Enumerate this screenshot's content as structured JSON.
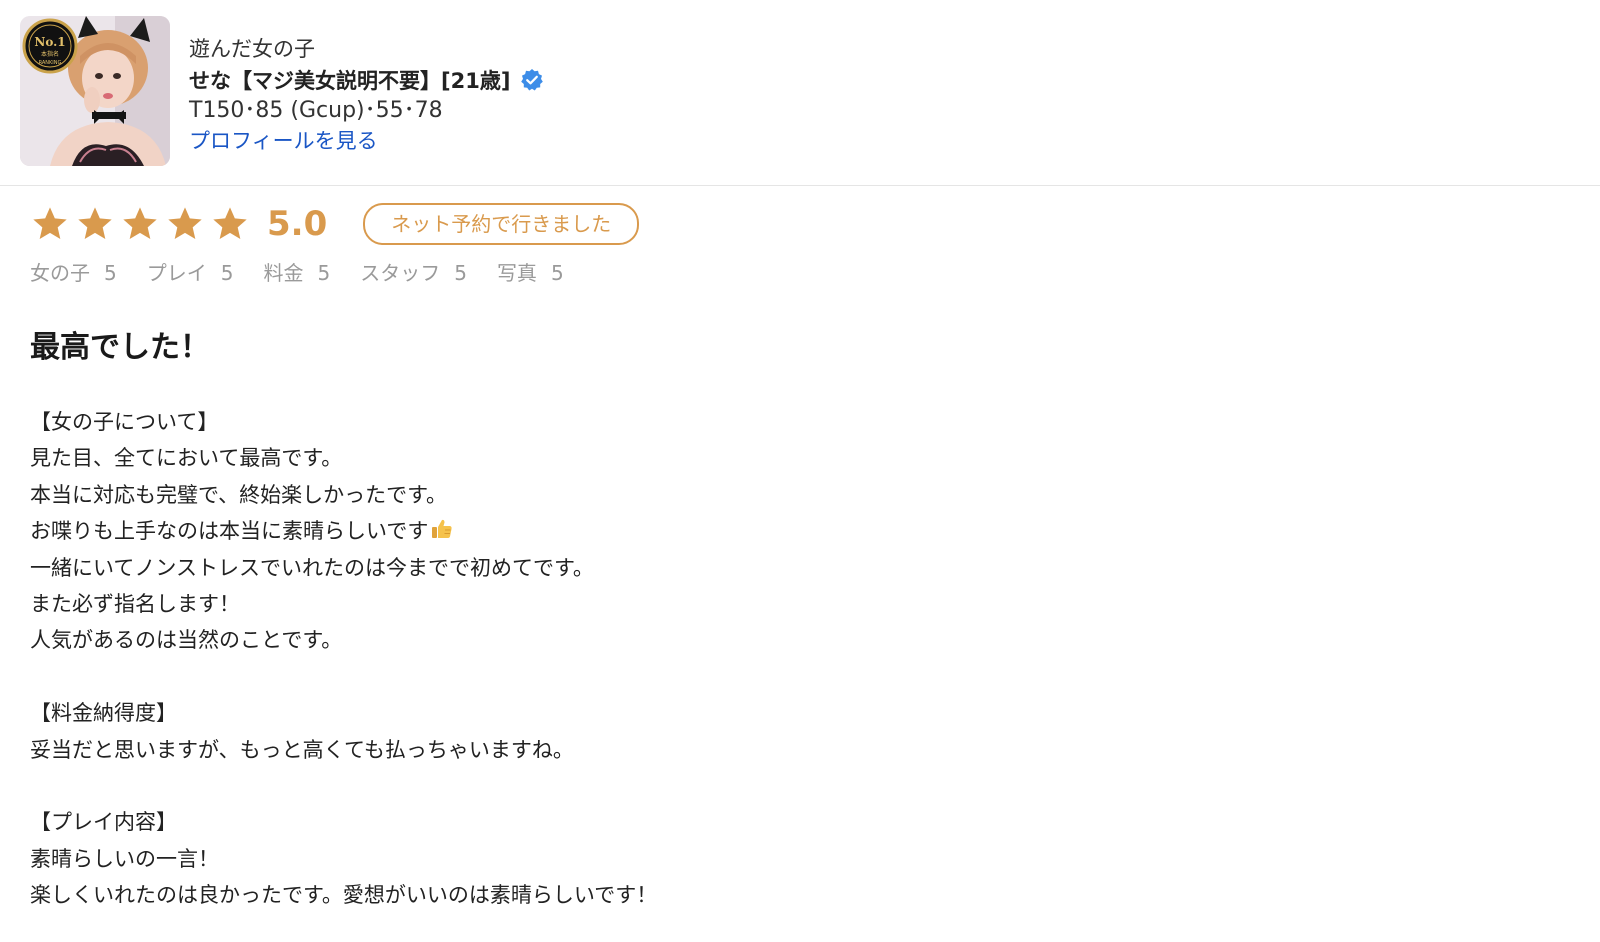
{
  "header": {
    "played_label": "遊んだ女の子",
    "girl_name": "せな【マジ美女説明不要】[21歳]",
    "girl_stats": "T150･85 (Gcup)･55･78",
    "profile_link": "プロフィールを見る",
    "verified_icon": "verified-check-icon",
    "badge": {
      "line1": "No.1",
      "line2": "本指名",
      "line3": "RANKING"
    }
  },
  "rating": {
    "stars": 5,
    "max_stars": 5,
    "score": "5.0",
    "booking_badge": "ネット予約で行きました",
    "star_color": "#d99a4d",
    "sub_ratings": [
      {
        "label": "女の子",
        "value": "5"
      },
      {
        "label": "プレイ",
        "value": "5"
      },
      {
        "label": "料金",
        "value": "5"
      },
      {
        "label": "スタッフ",
        "value": "5"
      },
      {
        "label": "写真",
        "value": "5"
      }
    ]
  },
  "review": {
    "title": "最高でした！",
    "lines": [
      "【女の子について】",
      "見た目、全てにおいて最高です。",
      "本当に対応も完璧で、終始楽しかったです。",
      "お喋りも上手なのは本当に素晴らしいです",
      "一緒にいてノンストレスでいれたのは今までで初めてです。",
      "また必ず指名します！",
      "人気があるのは当然のことです。",
      "",
      "【料金納得度】",
      "妥当だと思いますが、もっと高くても払っちゃいますね。",
      "",
      "【プレイ内容】",
      "素晴らしいの一言！",
      "楽しくいれたのは良かったです。愛想がいいのは素晴らしいです！"
    ],
    "thumbs_up_icon": "thumbs-up-icon"
  }
}
